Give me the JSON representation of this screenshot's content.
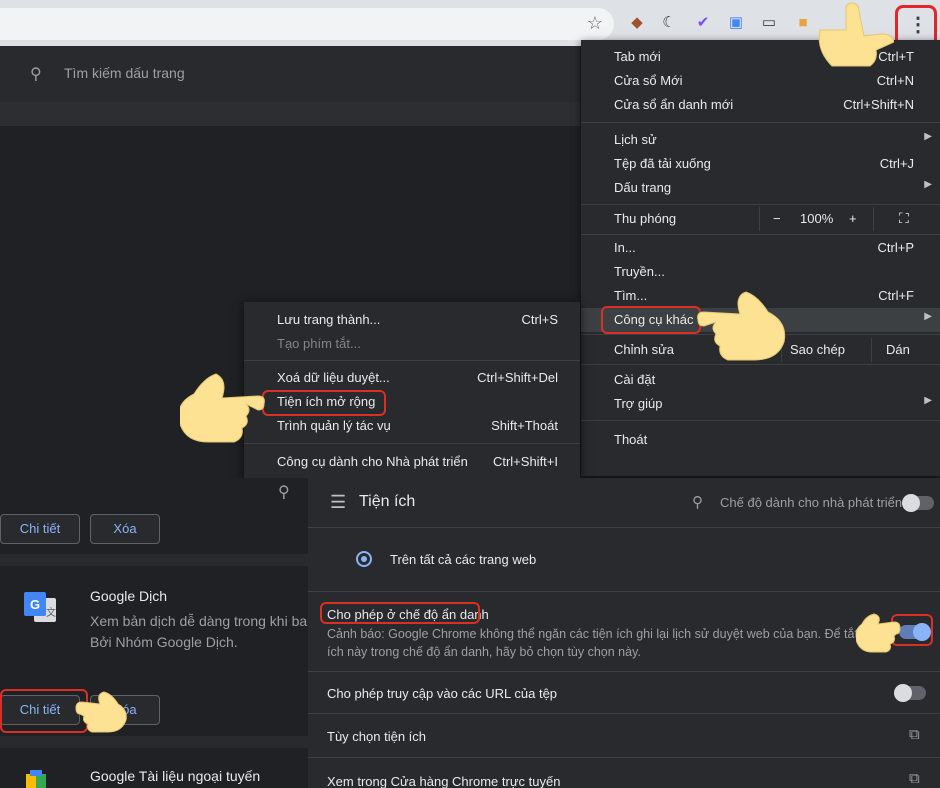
{
  "toolbar": {
    "search_placeholder": "Tìm kiếm dấu trang"
  },
  "chrome_menu": {
    "items": [
      {
        "label": "Tab mới",
        "shortcut": "Ctrl+T"
      },
      {
        "label": "Cửa sổ Mới",
        "shortcut": "Ctrl+N"
      },
      {
        "label": "Cửa sổ ẩn danh mới",
        "shortcut": "Ctrl+Shift+N"
      },
      {
        "label": "Lịch sử",
        "shortcut": ""
      },
      {
        "label": "Tệp đã tải xuống",
        "shortcut": "Ctrl+J"
      },
      {
        "label": "Dấu trang",
        "shortcut": ""
      },
      {
        "label": "In...",
        "shortcut": "Ctrl+P"
      },
      {
        "label": "Truyền...",
        "shortcut": ""
      },
      {
        "label": "Tìm...",
        "shortcut": "Ctrl+F"
      },
      {
        "label": "Công cụ khác",
        "shortcut": ""
      },
      {
        "label": "Cài đặt",
        "shortcut": ""
      },
      {
        "label": "Trợ giúp",
        "shortcut": ""
      },
      {
        "label": "Thoát",
        "shortcut": ""
      }
    ],
    "zoom": {
      "label": "Thu phóng",
      "minus": "−",
      "value": "100%",
      "plus": "+"
    },
    "edit": {
      "label": "Chỉnh sửa",
      "copy": "Sao chép",
      "paste": "Dán"
    }
  },
  "submenu": {
    "items": [
      {
        "label": "Lưu trang thành...",
        "shortcut": "Ctrl+S"
      },
      {
        "label": "Tạo phím tắt...",
        "shortcut": ""
      },
      {
        "label": "Xoá dữ liệu duyệt...",
        "shortcut": "Ctrl+Shift+Del"
      },
      {
        "label": "Tiện ích mở rộng",
        "shortcut": ""
      },
      {
        "label": "Trình quản lý tác vụ",
        "shortcut": "Shift+Thoát"
      },
      {
        "label": "Công cụ dành cho Nhà phát triển",
        "shortcut": "Ctrl+Shift+I"
      }
    ]
  },
  "ext_list": {
    "details_label": "Chi tiết",
    "remove_label": "Xóa",
    "translate": {
      "name": "Google Dịch",
      "desc_line1": "Xem bản dịch dễ dàng trong khi ban",
      "desc_line2": "Bởi Nhóm Google Dịch."
    },
    "docs_offline": {
      "name": "Google Tài liệu ngoại tuyến"
    }
  },
  "detail": {
    "title": "Tiện ích",
    "dev_mode": "Chế độ dành cho nhà phát triển",
    "on_all_sites": "Trên tất cả các trang web",
    "incognito_title": "Cho phép ở chế độ ẩn danh",
    "incognito_warn1": "Cảnh báo: Google Chrome không thể ngăn các tiện ích ghi lại lịch sử duyệt web của bạn. Để tắt tiện",
    "incognito_warn2": "ích này trong chế độ ẩn danh, hãy bỏ chọn tùy chọn này.",
    "file_urls": "Cho phép truy cập vào các URL của tệp",
    "ext_options": "Tùy chọn tiện ích",
    "view_store": "Xem trong Cửa hàng Chrome trực tuyến"
  },
  "colors": {
    "highlight": "#d93025",
    "accent": "#8ab4f8"
  }
}
